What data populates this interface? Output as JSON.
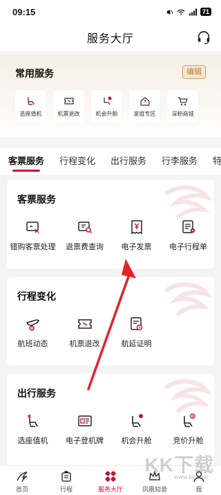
{
  "status_bar": {
    "time": "09:15",
    "battery": "71"
  },
  "header": {
    "title": "服务大厅"
  },
  "common": {
    "title": "常用服务",
    "edit_label": "编辑",
    "items": [
      {
        "label": "选座值机",
        "icon": "seat-icon"
      },
      {
        "label": "机票退改",
        "icon": "ticket-icon"
      },
      {
        "label": "机会升舱",
        "icon": "upgrade-seat-icon"
      },
      {
        "label": "家庭专区",
        "icon": "home-icon"
      },
      {
        "label": "深粉商城",
        "icon": "cart-icon"
      }
    ]
  },
  "tabs": [
    {
      "label": "客票服务",
      "active": true
    },
    {
      "label": "行程变化"
    },
    {
      "label": "出行服务"
    },
    {
      "label": "行李服务"
    },
    {
      "label": "特"
    }
  ],
  "sections": [
    {
      "title": "客票服务",
      "items": [
        {
          "label": "错购客票处理",
          "icon": "ticket-error-icon"
        },
        {
          "label": "退票费查询",
          "icon": "refund-search-icon"
        },
        {
          "label": "电子发票",
          "icon": "invoice-icon"
        },
        {
          "label": "电子行程单",
          "icon": "itinerary-icon"
        }
      ]
    },
    {
      "title": "行程变化",
      "items": [
        {
          "label": "航班动态",
          "icon": "flight-status-icon"
        },
        {
          "label": "机票退改",
          "icon": "ticket-icon"
        },
        {
          "label": "航延证明",
          "icon": "delay-cert-icon"
        }
      ]
    },
    {
      "title": "出行服务",
      "items": [
        {
          "label": "选座值机",
          "icon": "seat-icon"
        },
        {
          "label": "电子登机牌",
          "icon": "boarding-pass-icon"
        },
        {
          "label": "机会升舱",
          "icon": "upgrade-seat-icon"
        },
        {
          "label": "竞价升舱",
          "icon": "bid-upgrade-icon"
        }
      ]
    }
  ],
  "bottom_nav": [
    {
      "label": "首页",
      "icon": "home-logo-icon"
    },
    {
      "label": "行程",
      "icon": "luggage-icon"
    },
    {
      "label": "服务大厅",
      "icon": "service-hall-icon",
      "active": true
    },
    {
      "label": "凤凰知音",
      "icon": "crown-icon"
    },
    {
      "label": "我",
      "icon": "profile-icon"
    }
  ],
  "watermark": {
    "text": "KK下载",
    "url": "www.kkx.net"
  },
  "colors": {
    "accent": "#c8102e",
    "gold": "#b2823c"
  }
}
